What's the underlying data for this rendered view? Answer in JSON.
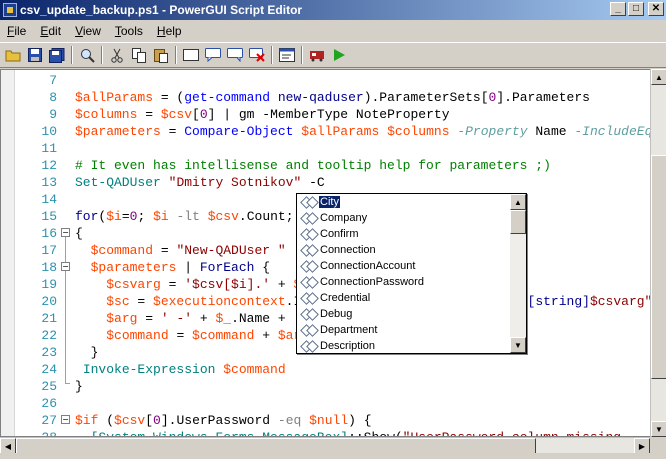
{
  "window": {
    "title": "csv_update_backup.ps1 - PowerGUI Script Editor",
    "minimize": "_",
    "maximize": "□",
    "close": "✕"
  },
  "menu": [
    {
      "label": "File",
      "u": "F",
      "rest": "ile"
    },
    {
      "label": "Edit",
      "u": "E",
      "rest": "dit"
    },
    {
      "label": "View",
      "u": "V",
      "rest": "iew"
    },
    {
      "label": "Tools",
      "u": "T",
      "rest": "ools"
    },
    {
      "label": "Help",
      "u": "H",
      "rest": "elp"
    }
  ],
  "toolbar": {
    "icons": [
      "open-icon",
      "save-icon",
      "save-all-icon",
      "find-icon",
      "cut-icon",
      "copy-icon",
      "paste-icon",
      "new-tab-icon",
      "comment-icon",
      "uncomment-icon",
      "clear-icon",
      "snippet-icon",
      "debug-icon",
      "run-icon"
    ],
    "colors": {
      "run": "#1fa51f",
      "debug": "#b22222"
    }
  },
  "editor": {
    "lines": [
      {
        "num": "7",
        "code": ""
      },
      {
        "num": "8",
        "code": "$allParams = (get-command new-qaduser).ParameterSets[0].Parameters"
      },
      {
        "num": "9",
        "code": "$columns = $csv[0] | gm -MemberType NoteProperty"
      },
      {
        "num": "10",
        "code": "$parameters = Compare-Object $allParams $columns -Property Name -IncludeEqual"
      },
      {
        "num": "11",
        "code": ""
      },
      {
        "num": "12",
        "code": "# It even has intellisense and tooltip help for parameters ;)"
      },
      {
        "num": "13",
        "code": "Set-QADUser \"Dmitry Sotnikov\" -C"
      },
      {
        "num": "14",
        "code": ""
      },
      {
        "num": "15",
        "code": "for($i=0; $i -lt $csv.Count; $i++)"
      },
      {
        "num": "16",
        "code": "{"
      },
      {
        "num": "17",
        "code": "  $command = \"New-QADUser \""
      },
      {
        "num": "18",
        "code": "  $parameters | ForEach {"
      },
      {
        "num": "19",
        "code": "    $csvarg = '$csv[$i].' + $_.Name"
      },
      {
        "num": "20",
        "code": "    $sc = $executioncontext.InvokeCommand.NewScriptBlock(\"[string]$csvarg\")"
      },
      {
        "num": "21",
        "code": "    $arg = ' -' + $_.Name + ' \"' + (& $sc) + '\"'"
      },
      {
        "num": "22",
        "code": "    $command = $command + $arg"
      },
      {
        "num": "23",
        "code": "  }"
      },
      {
        "num": "24",
        "code": " Invoke-Expression $command"
      },
      {
        "num": "25",
        "code": "}"
      },
      {
        "num": "26",
        "code": ""
      },
      {
        "num": "27",
        "code": "$if ($csv[0].UserPassword -eq $null) {"
      },
      {
        "num": "28",
        "code": "  [System.Windows.Forms.MessageBox]::Show(\"UserPassword column missing"
      }
    ]
  },
  "intellisense": {
    "items": [
      "City",
      "Company",
      "Confirm",
      "Connection",
      "ConnectionAccount",
      "ConnectionPassword",
      "Credential",
      "Debug",
      "Department",
      "Description"
    ],
    "selected": "City"
  }
}
